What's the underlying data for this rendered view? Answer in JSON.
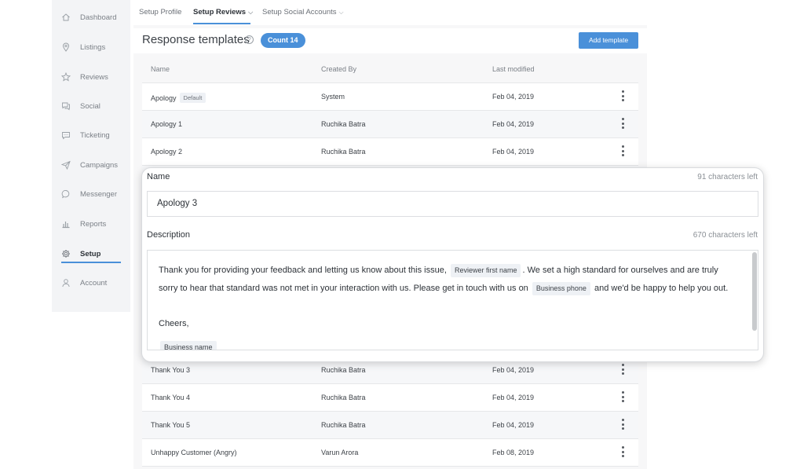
{
  "sidebar": {
    "items": [
      {
        "label": "Dashboard",
        "icon": "home-icon"
      },
      {
        "label": "Listings",
        "icon": "pin-icon"
      },
      {
        "label": "Reviews",
        "icon": "star-icon"
      },
      {
        "label": "Social",
        "icon": "chat-icon"
      },
      {
        "label": "Ticketing",
        "icon": "ticket-icon"
      },
      {
        "label": "Campaigns",
        "icon": "send-icon"
      },
      {
        "label": "Messenger",
        "icon": "messenger-icon"
      },
      {
        "label": "Reports",
        "icon": "bar-chart-icon"
      },
      {
        "label": "Setup",
        "icon": "gear-icon",
        "active": true
      },
      {
        "label": "Account",
        "icon": "user-icon"
      }
    ]
  },
  "tabs": {
    "profile": "Setup Profile",
    "reviews": "Setup Reviews",
    "social": "Setup Social Accounts",
    "chevron": "⌵"
  },
  "header": {
    "title": "Response templates",
    "help": "?",
    "count": "Count 14",
    "add_button": "Add template"
  },
  "table": {
    "columns": [
      "Name",
      "Created By",
      "Last modified"
    ],
    "rows_top": [
      {
        "name": "Apology",
        "tag": "Default",
        "created_by": "System",
        "modified": "Feb 04, 2019"
      },
      {
        "name": "Apology 1",
        "created_by": "Ruchika Batra",
        "modified": "Feb 04, 2019"
      },
      {
        "name": "Apology 2",
        "created_by": "Ruchika Batra",
        "modified": "Feb 04, 2019"
      }
    ],
    "rows_bottom": [
      {
        "name": "Thank You 3",
        "created_by": "Ruchika Batra",
        "modified": "Feb 04, 2019"
      },
      {
        "name": "Thank You 4",
        "created_by": "Ruchika Batra",
        "modified": "Feb 04, 2019"
      },
      {
        "name": "Thank You 5",
        "created_by": "Ruchika Batra",
        "modified": "Feb 04, 2019"
      },
      {
        "name": "Unhappy Customer (Angry)",
        "created_by": "Varun Arora",
        "modified": "Feb 08, 2019"
      }
    ]
  },
  "modal": {
    "name_label": "Name",
    "name_chars_left": "91 characters left",
    "name_value": "Apology 3",
    "desc_label": "Description",
    "desc_chars_left": "670 characters left",
    "desc_part1": "Thank you for providing your feedback and letting us know about this issue,",
    "placeholder_reviewer": "Reviewer first name",
    "desc_part2": ". We set a high standard for ourselves and are truly sorry to hear that standard was not met in your interaction with us. Please get in touch with us on",
    "placeholder_phone": "Business phone",
    "desc_part3": "and we'd be happy to help you out.",
    "cheers": "Cheers,",
    "placeholder_business": "Business name"
  }
}
